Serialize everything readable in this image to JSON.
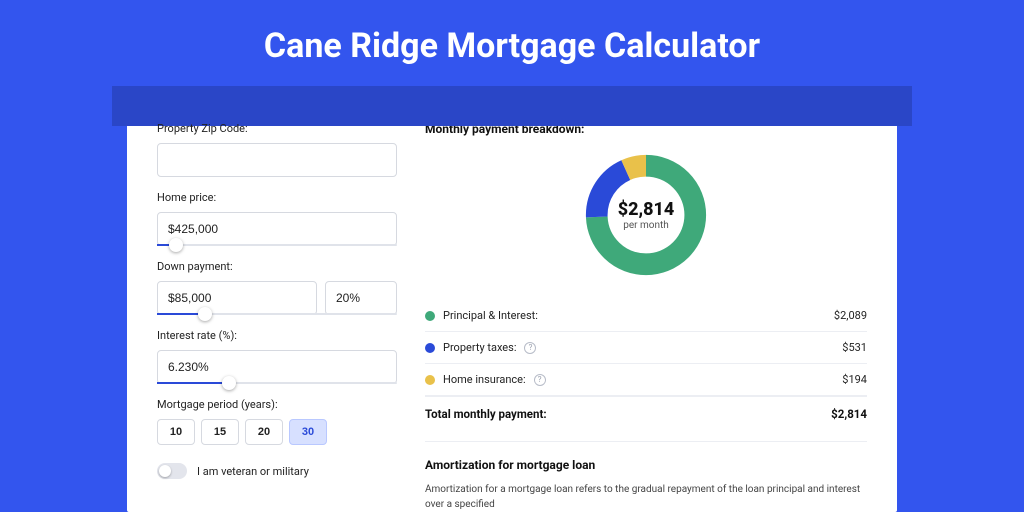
{
  "title": "Cane Ridge Mortgage Calculator",
  "form": {
    "zip_label": "Property Zip Code:",
    "zip_value": "",
    "home_price_label": "Home price:",
    "home_price_value": "$425,000",
    "home_price_slider_pct": 8,
    "down_payment_label": "Down payment:",
    "down_payment_value": "$85,000",
    "down_payment_pct": "20%",
    "down_payment_slider_pct": 20,
    "rate_label": "Interest rate (%):",
    "rate_value": "6.230%",
    "rate_slider_pct": 30,
    "period_label": "Mortgage period (years):",
    "periods": [
      "10",
      "15",
      "20",
      "30"
    ],
    "period_active_index": 3,
    "veteran_label": "I am veteran or military",
    "veteran_on": false
  },
  "breakdown": {
    "title": "Monthly payment breakdown:",
    "donut_amount": "$2,814",
    "donut_sub": "per month",
    "items": [
      {
        "label": "Principal & Interest:",
        "value": "$2,089",
        "color": "green",
        "info": false
      },
      {
        "label": "Property taxes:",
        "value": "$531",
        "color": "blue",
        "info": true
      },
      {
        "label": "Home insurance:",
        "value": "$194",
        "color": "yellow",
        "info": true
      }
    ],
    "total_label": "Total monthly payment:",
    "total_value": "$2,814"
  },
  "amort": {
    "title": "Amortization for mortgage loan",
    "text": "Amortization for a mortgage loan refers to the gradual repayment of the loan principal and interest over a specified"
  },
  "chart_data": {
    "type": "pie",
    "title": "Monthly payment breakdown",
    "series": [
      {
        "name": "Principal & Interest",
        "value": 2089,
        "color": "#3fa97a"
      },
      {
        "name": "Property taxes",
        "value": 531,
        "color": "#2a4ad8"
      },
      {
        "name": "Home insurance",
        "value": 194,
        "color": "#e9c14a"
      }
    ],
    "total": 2814,
    "center_label": "$2,814",
    "center_sublabel": "per month"
  }
}
